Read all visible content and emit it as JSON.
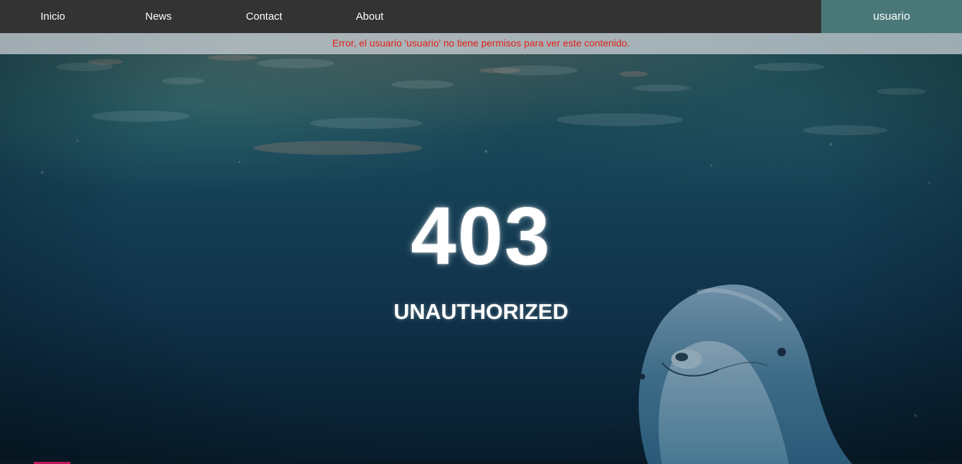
{
  "navbar": {
    "items": [
      {
        "label": "Inicio"
      },
      {
        "label": "News"
      },
      {
        "label": "Contact"
      },
      {
        "label": "About"
      }
    ],
    "user_label": "usuario"
  },
  "error_banner": {
    "message": "Error, el usuario 'usuario' no tiene permisos para ver este contenido."
  },
  "main": {
    "status_code": "403",
    "status_text": "UNAUTHORIZED"
  },
  "colors": {
    "navbar_bg": "#333333",
    "user_bg": "#4a7879",
    "error_text": "#e0201a"
  },
  "background": {
    "icon": "dolphin-underwater-image"
  }
}
